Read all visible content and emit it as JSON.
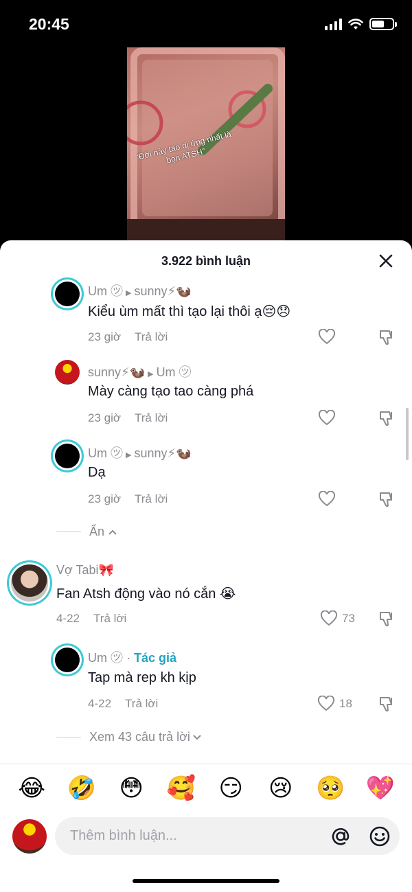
{
  "status": {
    "time": "20:45"
  },
  "video": {
    "caption": "\"Đời này tao dị ứng nhất là bọn ATSH\""
  },
  "sheet": {
    "title": "3.922 bình luận"
  },
  "comments": [
    {
      "user": "Um ㋡",
      "reply_to": "sunny⚡🦦",
      "text": "Kiểu ùm mất thì tạo lại thôi ạ😔😞",
      "time": "23 giờ",
      "reply": "Trả lời"
    },
    {
      "user": "sunny⚡🦦",
      "reply_to": "Um ㋡",
      "text": "Mày càng tạo tao càng phá",
      "time": "23 giờ",
      "reply": "Trả lời"
    },
    {
      "user": "Um ㋡",
      "reply_to": "sunny⚡🦦",
      "text": "Dạ",
      "time": "23 giờ",
      "reply": "Trả lời"
    },
    {
      "user": "Vợ Tabi🎀",
      "text": "Fan Atsh động vào nó cắn 😭",
      "time": "4-22",
      "reply": "Trả lời",
      "likes": "73"
    },
    {
      "user": "Um ㋡",
      "badge": "Tác giả",
      "text": "Tap mà rep kh kịp",
      "time": "4-22",
      "reply": "Trả lời",
      "likes": "18"
    }
  ],
  "toggles": {
    "hide": "Ẩn",
    "view_more": "Xem 43 câu trả lời"
  },
  "emojis": [
    "😂",
    "🤣",
    "😳",
    "🥰",
    "😏",
    "😢",
    "🥺",
    "💖"
  ],
  "input": {
    "placeholder": "Thêm bình luận..."
  },
  "colors": {
    "accent": "#3ec9d4",
    "author": "#20a4c2",
    "text": "#161823",
    "muted": "#8a8b91"
  }
}
